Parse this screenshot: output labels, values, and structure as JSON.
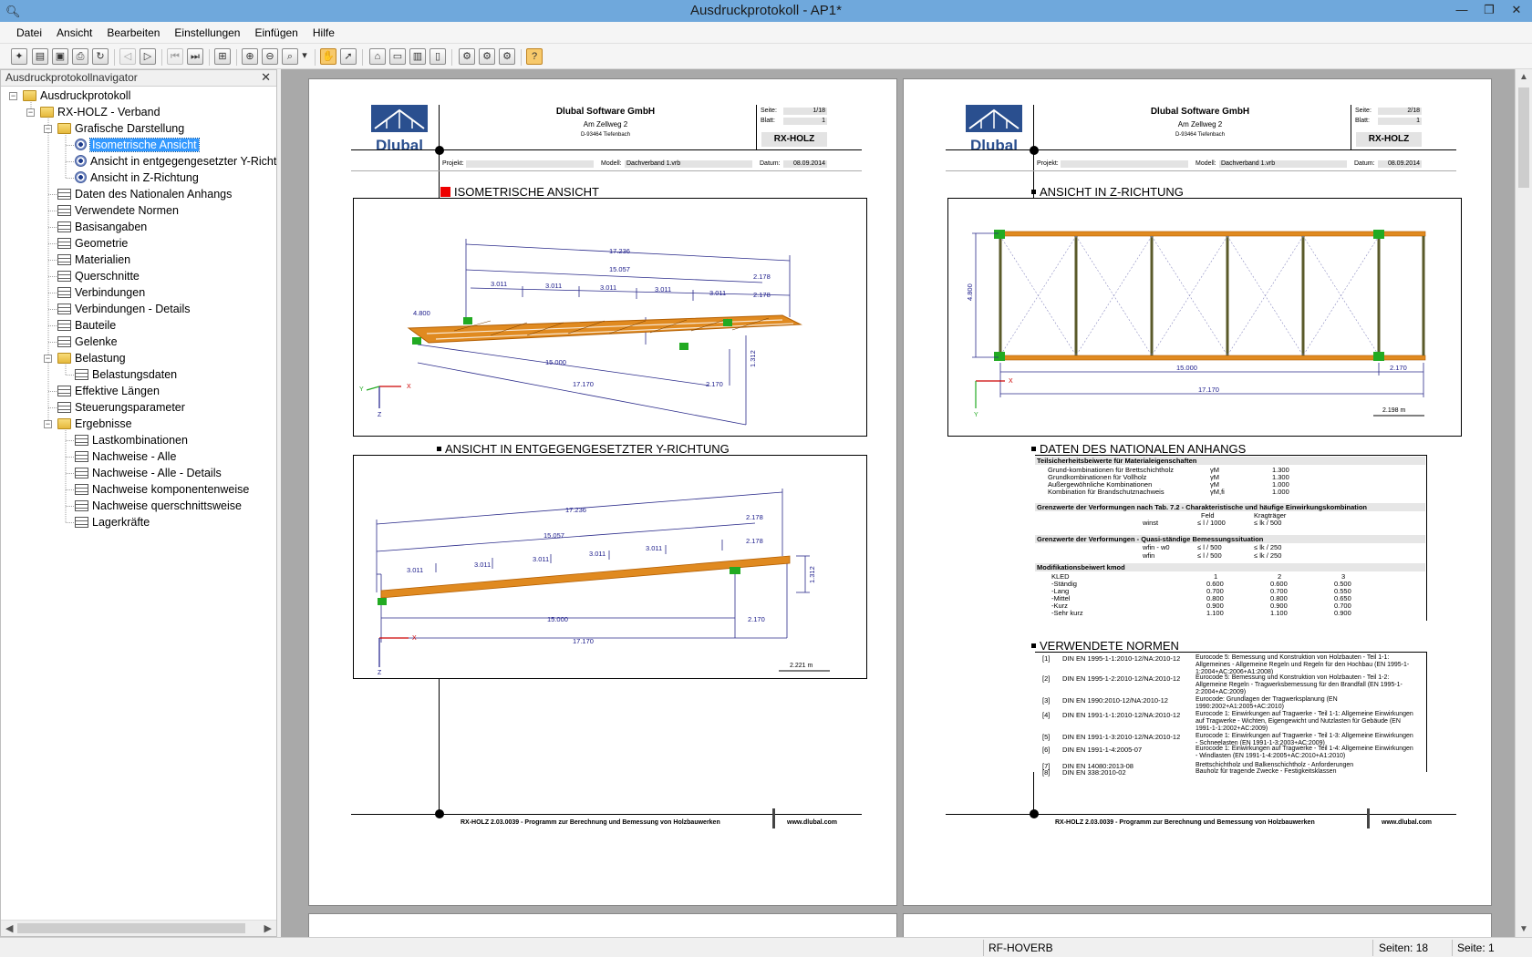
{
  "window": {
    "title": "Ausdruckprotokoll - AP1*",
    "controls": [
      "—",
      "❐",
      "✕"
    ]
  },
  "menu": [
    "Datei",
    "Ansicht",
    "Bearbeiten",
    "Einstellungen",
    "Einfügen",
    "Hilfe"
  ],
  "navigator": {
    "title": "Ausdruckprotokollnavigator",
    "close": "✕",
    "items": [
      {
        "label": "Ausdruckprotokoll",
        "level": 0,
        "icon": "folder-icon",
        "toggle": "−"
      },
      {
        "label": "RX-HOLZ - Verband",
        "level": 1,
        "icon": "folder-icon",
        "toggle": "−"
      },
      {
        "label": "Grafische Darstellung",
        "level": 2,
        "icon": "folder-icon",
        "toggle": "−"
      },
      {
        "label": "Isometrische Ansicht",
        "level": 3,
        "icon": "eye-icon",
        "selected": true
      },
      {
        "label": "Ansicht in entgegengesetzter Y-Richtung",
        "level": 3,
        "icon": "eye-icon"
      },
      {
        "label": "Ansicht in Z-Richtung",
        "level": 3,
        "icon": "eye-icon"
      },
      {
        "label": "Daten des Nationalen Anhangs",
        "level": 2,
        "icon": "table-icon"
      },
      {
        "label": "Verwendete Normen",
        "level": 2,
        "icon": "table-icon"
      },
      {
        "label": "Basisangaben",
        "level": 2,
        "icon": "table-icon"
      },
      {
        "label": "Geometrie",
        "level": 2,
        "icon": "table-icon"
      },
      {
        "label": "Materialien",
        "level": 2,
        "icon": "table-icon"
      },
      {
        "label": "Querschnitte",
        "level": 2,
        "icon": "table-icon"
      },
      {
        "label": "Verbindungen",
        "level": 2,
        "icon": "table-icon"
      },
      {
        "label": "Verbindungen - Details",
        "level": 2,
        "icon": "table-icon"
      },
      {
        "label": "Bauteile",
        "level": 2,
        "icon": "table-icon"
      },
      {
        "label": "Gelenke",
        "level": 2,
        "icon": "table-icon"
      },
      {
        "label": "Belastung",
        "level": 2,
        "icon": "folder-icon",
        "toggle": "−"
      },
      {
        "label": "Belastungsdaten",
        "level": 3,
        "icon": "table-icon"
      },
      {
        "label": "Effektive Längen",
        "level": 2,
        "icon": "table-icon"
      },
      {
        "label": "Steuerungsparameter",
        "level": 2,
        "icon": "table-icon"
      },
      {
        "label": "Ergebnisse",
        "level": 2,
        "icon": "folder-icon",
        "toggle": "−"
      },
      {
        "label": "Lastkombinationen",
        "level": 3,
        "icon": "table-icon"
      },
      {
        "label": "Nachweise - Alle",
        "level": 3,
        "icon": "table-icon"
      },
      {
        "label": "Nachweise - Alle - Details",
        "level": 3,
        "icon": "table-icon"
      },
      {
        "label": "Nachweise komponentenweise",
        "level": 3,
        "icon": "table-icon"
      },
      {
        "label": "Nachweise querschnittsweise",
        "level": 3,
        "icon": "table-icon"
      },
      {
        "label": "Lagerkräfte",
        "level": 3,
        "icon": "table-icon"
      }
    ]
  },
  "pages": [
    {
      "company": "Dlubal Software GmbH",
      "street": "Am Zellweg 2",
      "city": "D-93464 Tiefenbach",
      "seite_label": "Seite:",
      "seite": "1/18",
      "blatt_label": "Blatt:",
      "blatt": "1",
      "module": "RX-HOLZ",
      "projekt_label": "Projekt:",
      "modell_label": "Modell:",
      "modell": "Dachverband 1.vrb",
      "datum_label": "Datum:",
      "datum": "08.09.2014",
      "logo_text": "Dlubal",
      "footer_left": "RX-HOLZ 2.03.0039 - Programm zur Berechnung und Bemessung von Holzbauwerken",
      "footer_right": "www.dlubal.com",
      "sections": [
        "ISOMETRISCHE ANSICHT",
        "ANSICHT IN ENTGEGENGESETZTER Y-RICHTUNG"
      ]
    },
    {
      "company": "Dlubal Software GmbH",
      "street": "Am Zellweg 2",
      "city": "D-93464 Tiefenbach",
      "seite_label": "Seite:",
      "seite": "2/18",
      "blatt_label": "Blatt:",
      "blatt": "1",
      "module": "RX-HOLZ",
      "projekt_label": "Projekt:",
      "modell_label": "Modell:",
      "modell": "Dachverband 1.vrb",
      "datum_label": "Datum:",
      "datum": "08.09.2014",
      "logo_text": "Dlubal",
      "footer_left": "RX-HOLZ 2.03.0039 - Programm zur Berechnung und Bemessung von Holzbauwerken",
      "footer_right": "www.dlubal.com",
      "sections": [
        "ANSICHT IN Z-RICHTUNG",
        "DATEN DES NATIONALEN ANHANGS",
        "VERWENDETE NORMEN"
      ]
    }
  ],
  "drawings": {
    "iso": {
      "dims": [
        "17.236",
        "15.057",
        "3.011",
        "3.011",
        "3.011",
        "3.011",
        "3.011",
        "2.178",
        "2.178",
        "15.000",
        "17.170",
        "2.170",
        "1.312",
        "4.800"
      ],
      "axes": [
        "X",
        "Y",
        "Z"
      ]
    },
    "ydir": {
      "dims": [
        "17.236",
        "15.057",
        "3.011",
        "3.011",
        "3.011",
        "3.011",
        "3.011",
        "2.178",
        "2.178",
        "15.000",
        "2.170",
        "17.170",
        "1.312"
      ],
      "scale": "2.221 m",
      "axes": [
        "X",
        "Z"
      ]
    },
    "zdir": {
      "dims": [
        "4.800",
        "15.000",
        "2.170",
        "17.170"
      ],
      "scale": "2.198 m",
      "axes": [
        "X",
        "Y"
      ]
    }
  },
  "nat_annex": {
    "sec1_title": "Teilsicherheitsbeiwerte für Materialeigenschaften",
    "sec1_rows": [
      {
        "label": "Grund-kombinationen für Brettschichtholz",
        "sym": "γM",
        "val": "1.300"
      },
      {
        "label": "Grundkombinationen für Vollholz",
        "sym": "γM",
        "val": "1.300"
      },
      {
        "label": "Außergewöhnliche Kombinationen",
        "sym": "γM",
        "val": "1.000"
      },
      {
        "label": "Kombination für Brandschutznachweis",
        "sym": "γM,fi",
        "val": "1.000"
      }
    ],
    "sec2_title": "Grenzwerte der Verformungen nach Tab. 7.2 - Charakteristische und häufige Einwirkungskombination",
    "sec2_head": [
      "Feld",
      "Kragträger"
    ],
    "sec2_rows": [
      {
        "label": "winst",
        "v1": "≤ l / 1000",
        "v2": "≤ lk / 500"
      }
    ],
    "sec3_title": "Grenzwerte der Verformungen - Quasi-ständige Bemessungssituation",
    "sec3_rows": [
      {
        "label": "wfin - w0",
        "v1": "≤ l / 500",
        "v2": "≤ lk / 250"
      },
      {
        "label": "wfin",
        "v1": "≤ l / 500",
        "v2": "≤ lk / 250"
      }
    ],
    "sec4_title": "Modifikationsbeiwert kmod",
    "sec4_head": [
      "KLED",
      "1",
      "2",
      "3"
    ],
    "sec4_rows": [
      {
        "label": "-Ständig",
        "v": [
          "0.600",
          "0.600",
          "0.500"
        ]
      },
      {
        "label": "-Lang",
        "v": [
          "0.700",
          "0.700",
          "0.550"
        ]
      },
      {
        "label": "-Mittel",
        "v": [
          "0.800",
          "0.800",
          "0.650"
        ]
      },
      {
        "label": "-Kurz",
        "v": [
          "0.900",
          "0.900",
          "0.700"
        ]
      },
      {
        "label": "-Sehr kurz",
        "v": [
          "1.100",
          "1.100",
          "0.900"
        ]
      }
    ]
  },
  "norms": [
    {
      "n": "[1]",
      "code": "DIN EN 1995-1-1:2010-12/NA:2010-12",
      "desc": "Eurocode 5: Bemessung und Konstruktion von Holzbauten - Teil 1-1: Allgemeines - Allgemeine Regeln und Regeln für den Hochbau (EN 1995-1-1:2004+AC:2006+A1:2008)"
    },
    {
      "n": "[2]",
      "code": "DIN EN 1995-1-2:2010-12/NA:2010-12",
      "desc": "Eurocode 5: Bemessung und Konstruktion von Holzbauten - Teil 1-2: Allgemeine Regeln - Tragwerksbemessung für den Brandfall (EN 1995-1-2:2004+AC:2009)"
    },
    {
      "n": "[3]",
      "code": "DIN EN 1990:2010-12/NA:2010-12",
      "desc": "Eurocode: Grundlagen der Tragwerksplanung (EN 1990:2002+A1:2005+AC:2010)"
    },
    {
      "n": "[4]",
      "code": "DIN EN 1991-1-1:2010-12/NA:2010-12",
      "desc": "Eurocode 1: Einwirkungen auf Tragwerke - Teil 1-1: Allgemeine Einwirkungen auf Tragwerke - Wichten, Eigengewicht und Nutzlasten für Gebäude (EN 1991-1-1:2002+AC:2009)"
    },
    {
      "n": "[5]",
      "code": "DIN EN 1991-1-3:2010-12/NA:2010-12",
      "desc": "Eurocode 1: Einwirkungen auf Tragwerke - Teil 1-3: Allgemeine Einwirkungen - Schneelasten (EN 1991-1-3:2003+AC:2009)"
    },
    {
      "n": "[6]",
      "code": "DIN EN 1991-1-4:2005-07",
      "desc": "Eurocode 1: Einwirkungen auf Tragwerke - Teil 1-4: Allgemeine Einwirkungen - Windlasten (EN 1991-1-4:2005+AC:2010+A1:2010)"
    },
    {
      "n": "[7]",
      "code": "DIN EN 14080:2013-08",
      "desc": "Brettschichtholz und Balkenschichtholz - Anforderungen"
    },
    {
      "n": "[8]",
      "code": "DIN EN 338:2010-02",
      "desc": "Bauholz für tragende Zwecke - Festigkeitsklassen"
    }
  ],
  "status": {
    "model": "RF-HOVERB",
    "pages": "Seiten: 18",
    "page": "Seite: 1"
  },
  "colors": {
    "titlebar": "#6fa8dc",
    "timber": "#e08a20",
    "dim": "#2a2a8a",
    "support": "#22aa22",
    "selection": "#3399ff"
  }
}
